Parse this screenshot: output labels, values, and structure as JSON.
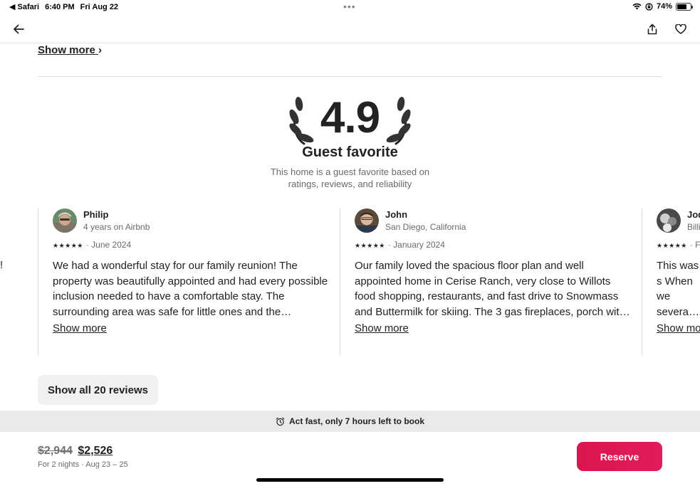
{
  "status_bar": {
    "back_app": "◀ Safari",
    "time": "6:40 PM",
    "date": "Fri Aug 22",
    "battery_percent": "74%",
    "battery_level": 0.74
  },
  "nav": {
    "back_icon": "arrow-left-icon",
    "share_icon": "share-icon",
    "heart_icon": "heart-icon"
  },
  "top_section": {
    "show_more_label": "Show more",
    "chevron": "›"
  },
  "rating": {
    "score": "4.9",
    "title": "Guest favorite",
    "subtitle": "This home is a guest favorite based on ratings, reviews, and reliability"
  },
  "reviews": [
    {
      "name": "Philip",
      "meta": "4 years on Airbnb",
      "stars": "★★★★★",
      "date": "· June 2024",
      "text": "We had a wonderful stay for our family reunion! The property was beautifully appointed and had every possible inclusion needed to have a comfortable stay. The surrounding area was safe for little ones and the neighborhood was lovely.",
      "more_label": "Show more"
    },
    {
      "name": "John",
      "meta": "San Diego, California",
      "stars": "★★★★★",
      "date": "· January 2024",
      "text": "Our family loved the spacious floor plan and well appointed home in Cerise Ranch, very close to Willots food shopping, restaurants, and fast drive to Snowmass and Buttermilk for skiing. The 3 gas fireplaces, porch with views were wonderful.",
      "more_label": "Show more"
    },
    {
      "name": "Jod",
      "meta": "Billi",
      "stars": "★★★★★",
      "date": "· Fe",
      "text": "This was s When we several m able to ge",
      "more_label": "Show mo"
    }
  ],
  "left_edge_text": "!",
  "show_all_label": "Show all 20 reviews",
  "banner": {
    "icon": "alarm-clock-icon",
    "text": "Act fast, only 7 hours left to book"
  },
  "footer": {
    "old_price": "$2,944",
    "new_price": "$2,526",
    "detail": "For 2 nights · Aug 23 – 25",
    "reserve_label": "Reserve",
    "reserve_color": "#dc1a53"
  }
}
